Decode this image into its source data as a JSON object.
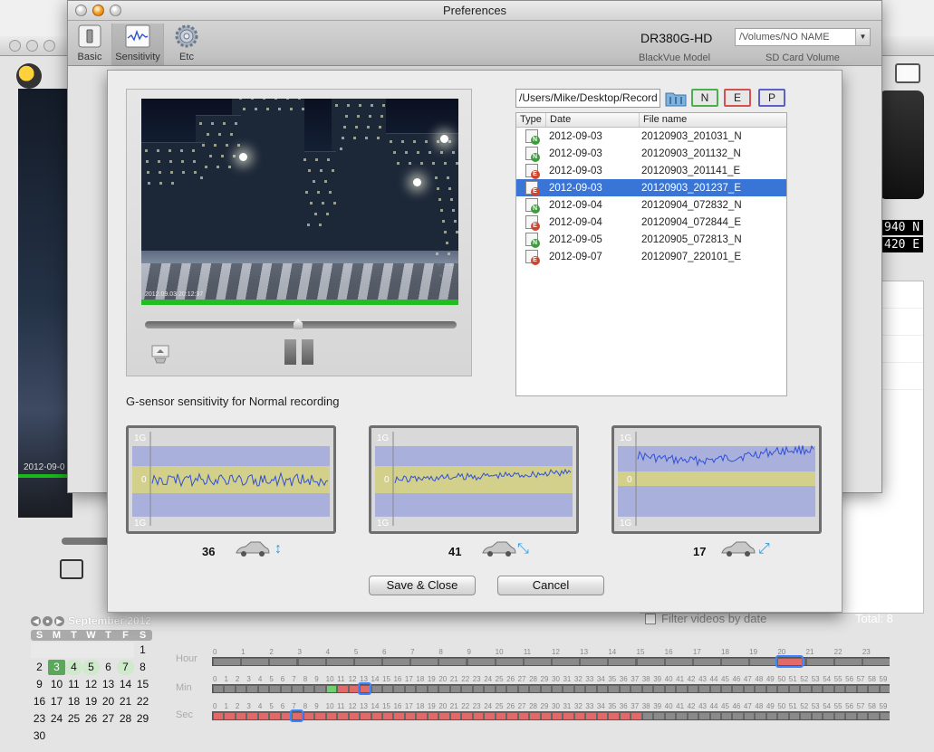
{
  "background_app": {
    "video_timestamp": "2012-09-0",
    "counters": [
      "940 N",
      "420 E"
    ],
    "filter_label": "Filter videos by date",
    "total_label": "Total: 8",
    "calendar": {
      "month_label": "September 2012",
      "weekdays": [
        "S",
        "M",
        "T",
        "W",
        "T",
        "F",
        "S"
      ],
      "days": [
        {
          "d": "",
          "s": "blank"
        },
        {
          "d": "",
          "s": "blank"
        },
        {
          "d": "",
          "s": "blank"
        },
        {
          "d": "",
          "s": "blank"
        },
        {
          "d": "",
          "s": "blank"
        },
        {
          "d": "",
          "s": "blank"
        },
        {
          "d": "1",
          "s": ""
        },
        {
          "d": "2",
          "s": ""
        },
        {
          "d": "3",
          "s": "sel"
        },
        {
          "d": "4",
          "s": "has"
        },
        {
          "d": "5",
          "s": "has"
        },
        {
          "d": "6",
          "s": ""
        },
        {
          "d": "7",
          "s": "has"
        },
        {
          "d": "8",
          "s": ""
        },
        {
          "d": "9",
          "s": ""
        },
        {
          "d": "10",
          "s": ""
        },
        {
          "d": "11",
          "s": ""
        },
        {
          "d": "12",
          "s": ""
        },
        {
          "d": "13",
          "s": ""
        },
        {
          "d": "14",
          "s": ""
        },
        {
          "d": "15",
          "s": ""
        },
        {
          "d": "16",
          "s": ""
        },
        {
          "d": "17",
          "s": ""
        },
        {
          "d": "18",
          "s": ""
        },
        {
          "d": "19",
          "s": ""
        },
        {
          "d": "20",
          "s": ""
        },
        {
          "d": "21",
          "s": ""
        },
        {
          "d": "22",
          "s": ""
        },
        {
          "d": "23",
          "s": ""
        },
        {
          "d": "24",
          "s": ""
        },
        {
          "d": "25",
          "s": ""
        },
        {
          "d": "26",
          "s": ""
        },
        {
          "d": "27",
          "s": ""
        },
        {
          "d": "28",
          "s": ""
        },
        {
          "d": "29",
          "s": ""
        },
        {
          "d": "30",
          "s": ""
        }
      ]
    },
    "timeline": {
      "hour_label": "Hour",
      "min_label": "Min",
      "sec_label": "Sec",
      "hour_count": 24,
      "minsec_count": 60,
      "hour_selected": 20,
      "min_selected": 13,
      "sec_selected": 7,
      "min_green": [
        10
      ],
      "min_red": [
        11,
        12,
        13
      ],
      "sec_red_until": 37
    }
  },
  "preferences": {
    "title": "Preferences",
    "toolbar": {
      "basic_label": "Basic",
      "sensitivity_label": "Sensitivity",
      "etc_label": "Etc"
    },
    "model_name": "DR380G-HD",
    "model_caption": "BlackVue Model",
    "sd_volume": "/Volumes/NO NAME",
    "sd_caption": "SD Card Volume"
  },
  "sheet": {
    "video_timestamp": "2012.09.03 20:12:37",
    "path": "/Users/Mike/Desktop/Record",
    "filters": {
      "n": "N",
      "e": "E",
      "p": "P"
    },
    "table_headers": {
      "type": "Type",
      "date": "Date",
      "file": "File name"
    },
    "files": [
      {
        "type": "N",
        "date": "2012-09-03",
        "name": "20120903_201031_N",
        "selected": false
      },
      {
        "type": "N",
        "date": "2012-09-03",
        "name": "20120903_201132_N",
        "selected": false
      },
      {
        "type": "E",
        "date": "2012-09-03",
        "name": "20120903_201141_E",
        "selected": false
      },
      {
        "type": "E",
        "date": "2012-09-03",
        "name": "20120903_201237_E",
        "selected": true
      },
      {
        "type": "N",
        "date": "2012-09-04",
        "name": "20120904_072832_N",
        "selected": false
      },
      {
        "type": "E",
        "date": "2012-09-04",
        "name": "20120904_072844_E",
        "selected": false
      },
      {
        "type": "N",
        "date": "2012-09-05",
        "name": "20120905_072813_N",
        "selected": false
      },
      {
        "type": "E",
        "date": "2012-09-07",
        "name": "20120907_220101_E",
        "selected": false
      }
    ],
    "gsensor_title": "G-sensor sensitivity for Normal recording",
    "graphs": [
      {
        "value": "36",
        "axis_top": "1G",
        "axis_mid": "0",
        "axis_bottom": "1G",
        "band": "center",
        "arrow": "↕"
      },
      {
        "value": "41",
        "axis_top": "1G",
        "axis_mid": "0",
        "axis_bottom": "1G",
        "band": "center",
        "arrow": "⤡"
      },
      {
        "value": "17",
        "axis_top": "1G",
        "axis_mid": "0",
        "axis_bottom": "1G",
        "band": "top",
        "arrow": "⤢"
      }
    ],
    "save_label": "Save & Close",
    "cancel_label": "Cancel"
  },
  "colors": {
    "selection": "#3875d7",
    "normal_badge": "#3d9c3d",
    "event_badge": "#d0452d",
    "graph_band": "#d2d08a",
    "graph_outer": "#aab0dc",
    "graph_line": "#2f50d8"
  }
}
